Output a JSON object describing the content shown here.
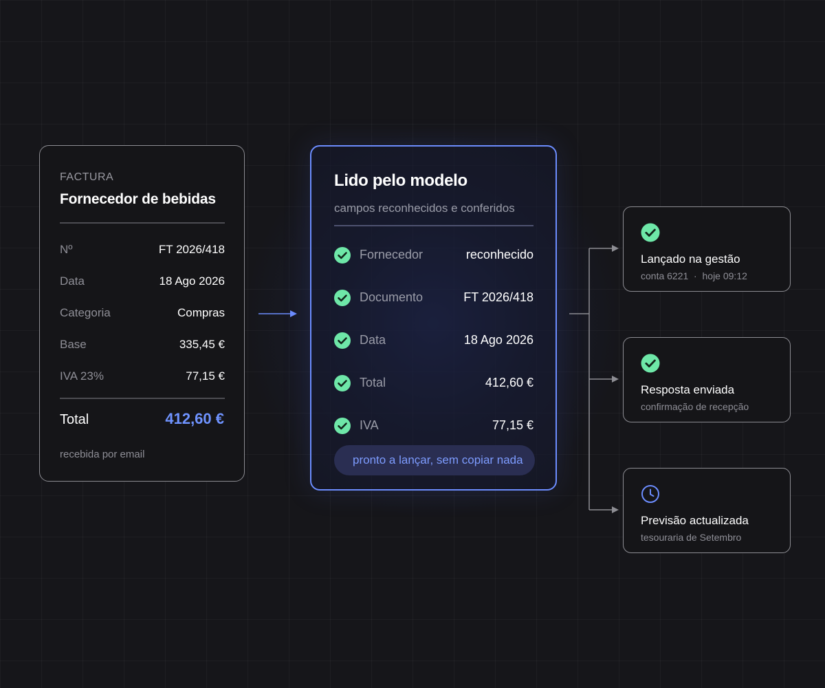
{
  "invoice": {
    "kicker": "FACTURA",
    "title": "Fornecedor de bebidas",
    "rows": [
      {
        "label": "Nº",
        "value": "FT 2026/418"
      },
      {
        "label": "Data",
        "value": "18 Ago 2026"
      },
      {
        "label": "Categoria",
        "value": "Compras"
      },
      {
        "label": "Base",
        "value": "335,45 €"
      },
      {
        "label": "IVA 23%",
        "value": "77,15 €"
      }
    ],
    "total_label": "Total",
    "total_value": "412,60 €",
    "footer": "recebida por email"
  },
  "model": {
    "title": "Lido pelo modelo",
    "subtitle": "campos reconhecidos e conferidos",
    "rows": [
      {
        "label": "Fornecedor",
        "value": "reconhecido"
      },
      {
        "label": "Documento",
        "value": "FT 2026/418"
      },
      {
        "label": "Data",
        "value": "18 Ago 2026"
      },
      {
        "label": "Total",
        "value": "412,60 €"
      },
      {
        "label": "IVA",
        "value": "77,15 €"
      }
    ],
    "status_pill": "pronto a lançar, sem copiar nada"
  },
  "outputs": [
    {
      "icon": "check-circle-icon",
      "title": "Lançado na gestão",
      "detail": "conta 6221  ·  hoje 09:12"
    },
    {
      "icon": "check-circle-icon",
      "title": "Resposta enviada",
      "detail": "confirmação de recepção"
    },
    {
      "icon": "clock-icon",
      "title": "Previsão actualizada",
      "detail": "tesouraria de Setembro"
    }
  ],
  "colors": {
    "accent": "#6c8dff",
    "check": "#6ee7a8",
    "background": "#16161a",
    "border": "#8d8d93"
  }
}
